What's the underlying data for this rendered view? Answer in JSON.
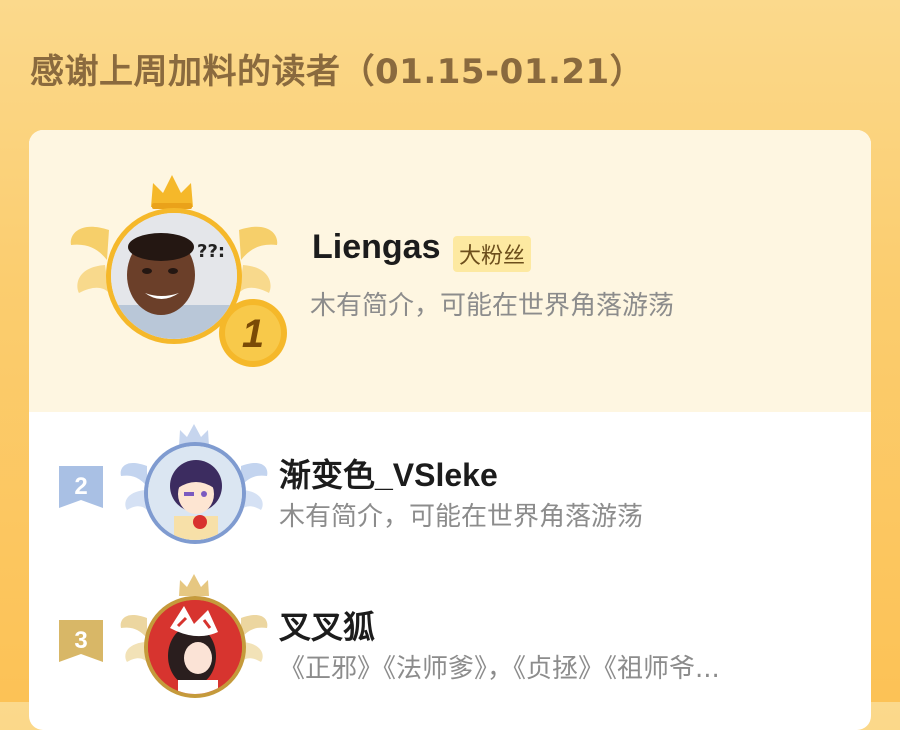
{
  "header": {
    "title": "感谢上周加料的读者（01.15-01.21）"
  },
  "readers": [
    {
      "rank": "1",
      "name": "Liengas",
      "badge": "大粉丝",
      "description": "木有简介，可能在世界角落游荡",
      "avatar_icon": "avatar-photo-man"
    },
    {
      "rank": "2",
      "name": "渐变色_VSleke",
      "description": "木有简介，可能在世界角落游荡",
      "avatar_icon": "avatar-anime-girl-purple"
    },
    {
      "rank": "3",
      "name": "叉叉狐",
      "description": "《正邪》《法师爹》，《贞拯》《祖师爷...",
      "avatar_icon": "avatar-anime-fox-mask"
    }
  ],
  "colors": {
    "background_top": "#fbd98c",
    "background_bottom": "#fcc256",
    "title": "#8a6a3e",
    "top_section": "#fef6e1",
    "gold": "#f5b82a",
    "silver": "#9fb7dd",
    "bronze": "#d7b25a",
    "badge_bg": "#fde9a1"
  }
}
